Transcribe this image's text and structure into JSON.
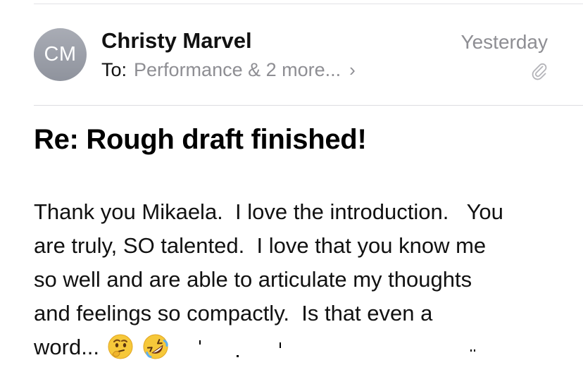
{
  "message": {
    "avatar_initials": "CM",
    "sender_name": "Christy Marvel",
    "to_label": "To:",
    "recipients": "Performance & 2 more...",
    "chevron_glyph": "›",
    "date": "Yesterday",
    "attachment_icon": "paperclip-icon",
    "subject": "Re: Rough draft finished!",
    "body_lines": [
      "Thank you Mikaela.  I love the introduction.   You",
      "are truly, SO talented.  I love that you know me",
      "so well and are able to articulate my thoughts",
      "and feelings so compactly.  Is that even a",
      "word..."
    ],
    "emojis": [
      "thinking-face-emoji",
      "rolling-on-floor-laughing-emoji"
    ]
  },
  "colors": {
    "avatar_bg": "#9a9ea8",
    "secondary_text": "#8e8e93",
    "divider": "#dcdce0"
  }
}
